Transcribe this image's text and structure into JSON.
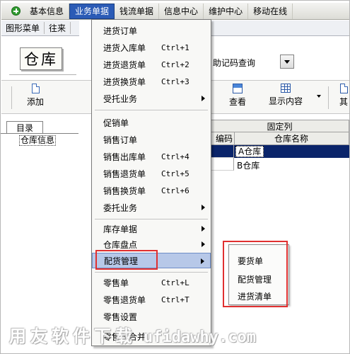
{
  "menubar": {
    "items": [
      {
        "label": "基本信息"
      },
      {
        "label": "业务单据"
      },
      {
        "label": "钱流单据"
      },
      {
        "label": "信息中心"
      },
      {
        "label": "维护中心"
      },
      {
        "label": "移动在线"
      }
    ]
  },
  "navbar": {
    "items": [
      {
        "label": "图形菜单"
      },
      {
        "label": "往来"
      }
    ]
  },
  "title": "仓库",
  "search": {
    "label": "助记码查询"
  },
  "toolbar": {
    "add_label": "添加",
    "view_label": "查看",
    "display_label": "显示内容",
    "overflow_label": "其"
  },
  "tree": {
    "tab_label": "目录",
    "node_label": "仓库信息"
  },
  "grid": {
    "fixed_header": "固定列",
    "col0_header": "编码",
    "col1_header": "仓库名称",
    "rows": [
      {
        "name": "A仓库",
        "selected": true
      },
      {
        "name": "B仓库",
        "selected": false
      }
    ]
  },
  "dropdown": {
    "items": [
      {
        "label": "进货订单",
        "shortcut": ""
      },
      {
        "label": "进货入库单",
        "shortcut": "Ctrl+1"
      },
      {
        "label": "进货退货单",
        "shortcut": "Ctrl+2"
      },
      {
        "label": "进货换货单",
        "shortcut": "Ctrl+3"
      },
      {
        "label": "受托业务",
        "shortcut": "",
        "submenu": true
      },
      {
        "label": "促销单",
        "shortcut": ""
      },
      {
        "label": "销售订单",
        "shortcut": ""
      },
      {
        "label": "销售出库单",
        "shortcut": "Ctrl+4"
      },
      {
        "label": "销售退货单",
        "shortcut": "Ctrl+5"
      },
      {
        "label": "销售换货单",
        "shortcut": "Ctrl+6"
      },
      {
        "label": "委托业务",
        "shortcut": "",
        "submenu": true
      },
      {
        "label": "库存单据",
        "shortcut": "",
        "submenu": true
      },
      {
        "label": "仓库盘点",
        "shortcut": "",
        "submenu": true
      },
      {
        "label": "配货管理",
        "shortcut": "",
        "submenu": true,
        "highlight": true
      },
      {
        "label": "零售单",
        "shortcut": "Ctrl+L"
      },
      {
        "label": "零售退货单",
        "shortcut": "Ctrl+T"
      },
      {
        "label": "零售设置",
        "shortcut": ""
      },
      {
        "label": "零售单合并",
        "shortcut": ""
      }
    ]
  },
  "submenu": {
    "items": [
      {
        "label": "要货单"
      },
      {
        "label": "配货管理"
      },
      {
        "label": "进货清单"
      }
    ]
  },
  "watermark": {
    "cn": "用友软件下载",
    "en": "ufidawhy.com"
  },
  "colors": {
    "highlight_border": "#e03030",
    "menu_active": "#2b5bb6",
    "selected_row": "#0a246a"
  }
}
